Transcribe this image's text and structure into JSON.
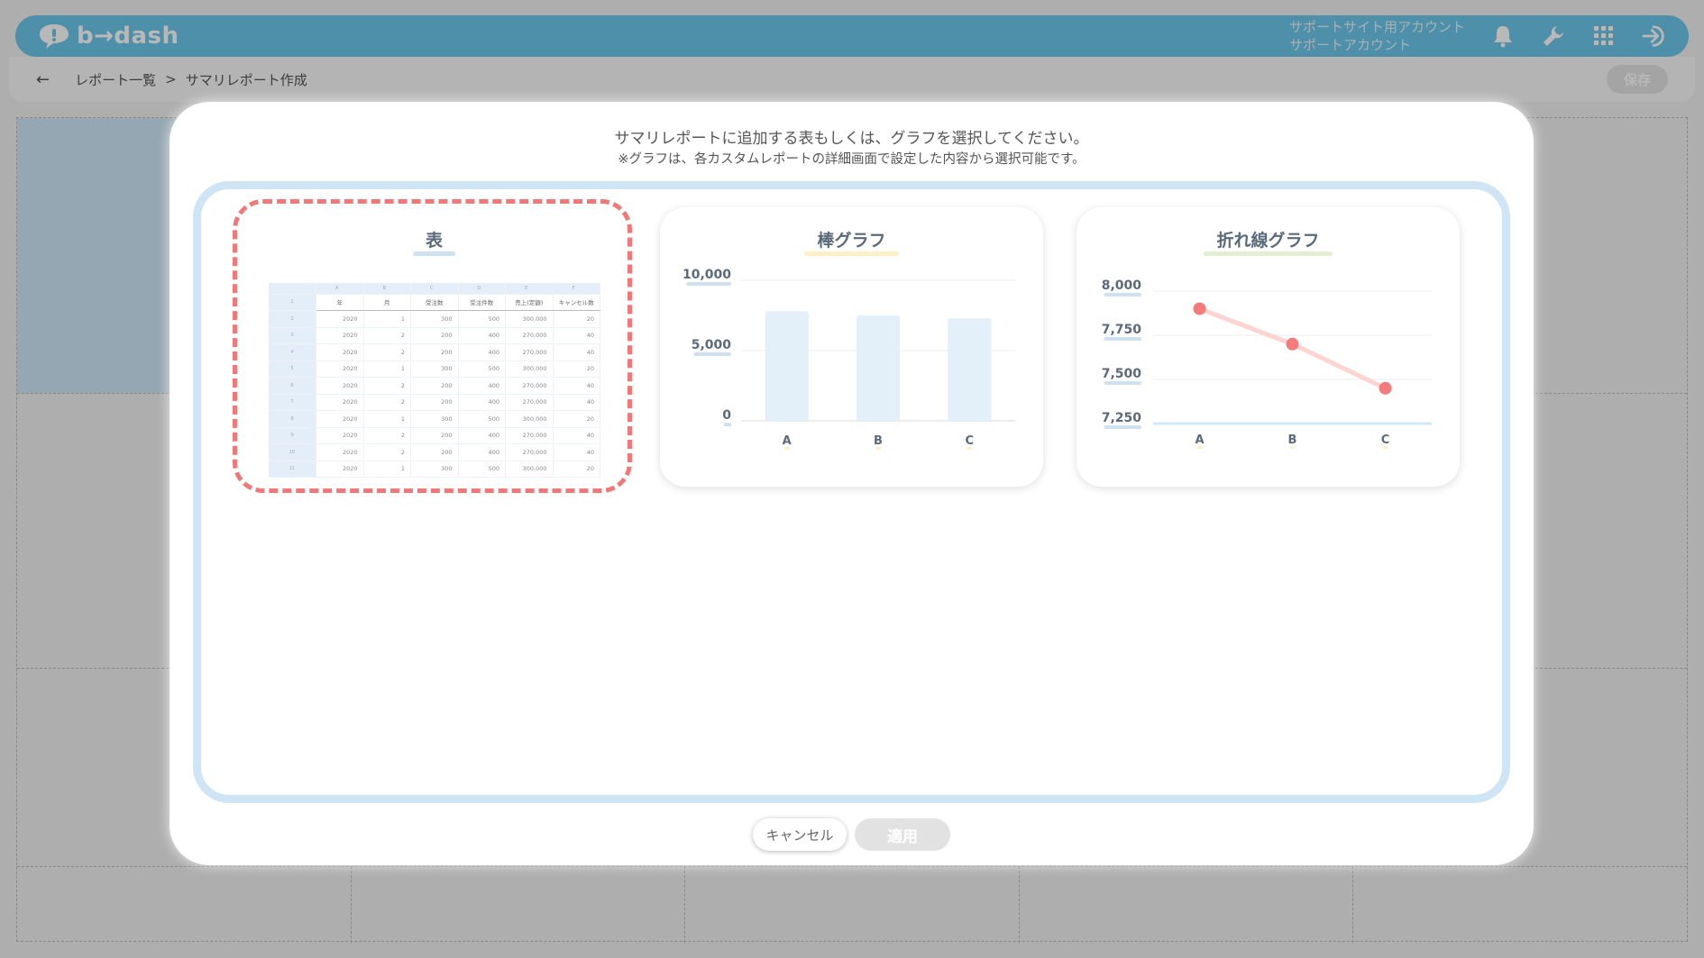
{
  "app": {
    "logo_text": "b→dash"
  },
  "header": {
    "account_line1": "サポートサイト用アカウント",
    "account_line2": "サポートアカウント"
  },
  "breadcrumb": {
    "back": "←",
    "parent": "レポート一覧",
    "separator": ">",
    "current": "サマリレポート作成"
  },
  "toolbar": {
    "save_label": "保存"
  },
  "modal": {
    "message": "サマリレポートに追加する表もしくは、グラフを選択してください。",
    "note": "※グラフは、各カスタムレポートの詳細画面で設定した内容から選択可能です。",
    "cancel_label": "キャンセル",
    "apply_label": "適用"
  },
  "cards": {
    "table": {
      "title": "表"
    },
    "bar": {
      "title": "棒グラフ"
    },
    "line": {
      "title": "折れ線グラフ"
    }
  },
  "mini_table": {
    "column_letters": [
      "",
      "A",
      "B",
      "C",
      "D",
      "E",
      "F"
    ],
    "headers": [
      "年",
      "月",
      "受注数",
      "受注件数",
      "売上(定額)",
      "キャンセル数"
    ],
    "rows": [
      {
        "n": "2",
        "cells": [
          "2020",
          "1",
          "300",
          "500",
          "300,000",
          "20"
        ]
      },
      {
        "n": "3",
        "cells": [
          "2020",
          "2",
          "200",
          "400",
          "270,000",
          "40"
        ]
      },
      {
        "n": "4",
        "cells": [
          "2020",
          "2",
          "200",
          "400",
          "270,000",
          "40"
        ]
      },
      {
        "n": "5",
        "cells": [
          "2020",
          "1",
          "300",
          "500",
          "300,000",
          "20"
        ]
      },
      {
        "n": "6",
        "cells": [
          "2020",
          "2",
          "200",
          "400",
          "270,000",
          "40"
        ]
      },
      {
        "n": "7",
        "cells": [
          "2020",
          "2",
          "200",
          "400",
          "270,000",
          "40"
        ]
      },
      {
        "n": "8",
        "cells": [
          "2020",
          "1",
          "300",
          "500",
          "300,000",
          "20"
        ]
      },
      {
        "n": "9",
        "cells": [
          "2020",
          "2",
          "200",
          "400",
          "270,000",
          "40"
        ]
      },
      {
        "n": "10",
        "cells": [
          "2020",
          "2",
          "200",
          "400",
          "270,000",
          "40"
        ]
      },
      {
        "n": "11",
        "cells": [
          "2020",
          "1",
          "300",
          "500",
          "300,000",
          "20"
        ]
      }
    ]
  },
  "colors": {
    "header_bg": "#6cc7ea",
    "selected_border": "#f07878",
    "bar_fill": "#e3eff9",
    "line_stroke": "#ffd3d0",
    "point_fill": "#f27b7b",
    "area_border": "#cfe4f5"
  },
  "chart_data": [
    {
      "type": "bar",
      "title": "棒グラフ",
      "categories": [
        "A",
        "B",
        "C"
      ],
      "values": [
        7800,
        7500,
        7300
      ],
      "ylim": [
        0,
        10000
      ],
      "yticks": [
        "0",
        "5,000",
        "10,000"
      ],
      "ytick_values": [
        0,
        5000,
        10000
      ],
      "grid": true
    },
    {
      "type": "line",
      "title": "折れ線グラフ",
      "categories": [
        "A",
        "B",
        "C"
      ],
      "values": [
        7900,
        7700,
        7450
      ],
      "ylim": [
        7250,
        8000
      ],
      "yticks": [
        "7,250",
        "7,500",
        "7,750",
        "8,000"
      ],
      "ytick_values": [
        7250,
        7500,
        7750,
        8000
      ],
      "grid": true
    }
  ]
}
